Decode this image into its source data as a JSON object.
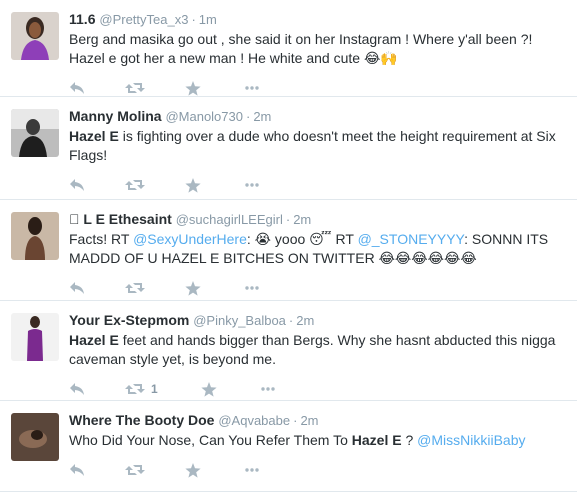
{
  "tweets": [
    {
      "name": "11.6",
      "handle": "@PrettyTea_x3",
      "dot": "·",
      "time": "1m",
      "text_a": "Berg and masika go out , she said it on her Instagram ! Where y'all been ?! Hazel e got her a new man ! He white and cute",
      "emojis": [
        "😂",
        "🙌"
      ],
      "retweets": ""
    },
    {
      "name": "Manny Molina",
      "handle": "@Manolo730",
      "dot": "·",
      "time": "2m",
      "bold": "Hazel E",
      "text_a": " is fighting over a dude who doesn't meet the height requirement at Six Flags!",
      "retweets": ""
    },
    {
      "name": "󾓦 L E Ethesaint",
      "handle": "@suchagirlLEEgirl",
      "dot": "·",
      "time": "2m",
      "text_a": "Facts! RT ",
      "link1": "@SexyUnderHere",
      "text_b": ": ",
      "emoji1": "😭",
      "text_c": " yooo ",
      "emoji2": "😴",
      "text_d": " RT ",
      "link2": "@_STONEYYYY",
      "text_e": ": SONNN ITS MADDD OF U HAZEL E BITCHES ON TWITTER ",
      "emoji3": "😂😂😂😂😂😂",
      "retweets": ""
    },
    {
      "name": "Your Ex-Stepmom",
      "handle": "@Pinky_Balboa",
      "dot": "·",
      "time": "2m",
      "bold": "Hazel E",
      "text_a": " feet and hands bigger than Bergs. Why she hasnt abducted this nigga caveman style yet, is beyond me.",
      "retweets": "1"
    },
    {
      "name": "Where The Booty Doe",
      "handle": "@Aqvababe",
      "dot": "·",
      "time": "2m",
      "text_a": "Who Did Your Nose, Can You Refer Them To ",
      "bold": "Hazel E",
      "text_b": " ? ",
      "link1": "@MissNikkiiBaby",
      "retweets": ""
    }
  ],
  "icons": {
    "reply": "reply-icon",
    "retweet": "retweet-icon",
    "favorite": "star-icon",
    "more": "more-icon"
  },
  "colors": {
    "link": "#55acee",
    "meta": "#8899a6",
    "action": "#aab8c2",
    "divider": "#e1e8ed"
  }
}
